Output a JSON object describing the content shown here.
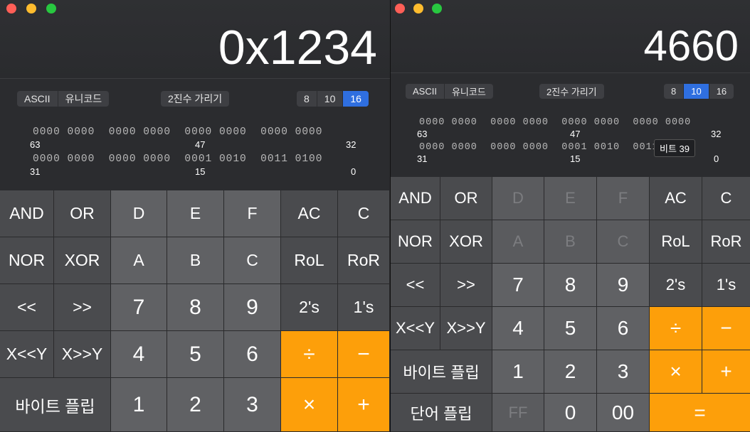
{
  "left": {
    "display": "0x1234",
    "ascii_label": "ASCII",
    "unicode_label": "유니코드",
    "hide_binary_label": "2진수 가리기",
    "bases": [
      "8",
      "10",
      "16"
    ],
    "selected_base": "16",
    "bits_row1": "0000 0000  0000 0000  0000 0000  0000 0000",
    "bits_row2": "0000 0000  0000 0000  0001 0010  0011 0100",
    "bit_labels": {
      "b63": "63",
      "b47": "47",
      "b32": "32",
      "b31": "31",
      "b15": "15",
      "b0": "0"
    },
    "keys": {
      "and": "AND",
      "or": "OR",
      "d": "D",
      "e": "E",
      "f": "F",
      "ac": "AC",
      "c": "C",
      "nor": "NOR",
      "xor": "XOR",
      "a": "A",
      "b": "B",
      "c2": "C",
      "rol": "RoL",
      "ror": "RoR",
      "shl": "<<",
      "shr": ">>",
      "n7": "7",
      "n8": "8",
      "n9": "9",
      "twos": "2's",
      "ones": "1's",
      "xshly": "X<<Y",
      "xshry": "X>>Y",
      "n4": "4",
      "n5": "5",
      "n6": "6",
      "div": "÷",
      "minus": "−",
      "byteflip": "바이트 플립",
      "n1": "1",
      "n2": "2",
      "n3": "3",
      "mul": "×",
      "plus": "+"
    }
  },
  "right": {
    "display": "4660",
    "ascii_label": "ASCII",
    "unicode_label": "유니코드",
    "hide_binary_label": "2진수 가리기",
    "bases": [
      "8",
      "10",
      "16"
    ],
    "selected_base": "10",
    "bits_row1": "0000 0000  0000 0000  0000 0000  0000 0000",
    "bits_row2": "0000 0000  0000 0000  0001 0010  0011 0100",
    "bit_labels": {
      "b63": "63",
      "b47": "47",
      "b32": "32",
      "b31": "31",
      "b15": "15",
      "b0": "0"
    },
    "tooltip": "비트 39",
    "keys": {
      "and": "AND",
      "or": "OR",
      "d": "D",
      "e": "E",
      "f": "F",
      "ac": "AC",
      "c": "C",
      "nor": "NOR",
      "xor": "XOR",
      "a": "A",
      "b": "B",
      "c2": "C",
      "rol": "RoL",
      "ror": "RoR",
      "shl": "<<",
      "shr": ">>",
      "n7": "7",
      "n8": "8",
      "n9": "9",
      "twos": "2's",
      "ones": "1's",
      "xshly": "X<<Y",
      "xshry": "X>>Y",
      "n4": "4",
      "n5": "5",
      "n6": "6",
      "div": "÷",
      "minus": "−",
      "byteflip": "바이트 플립",
      "n1": "1",
      "n2": "2",
      "n3": "3",
      "mul": "×",
      "plus": "+",
      "wordflip": "단어 플립",
      "ff": "FF",
      "n0": "0",
      "n00": "00",
      "equals": "="
    }
  },
  "colors": {
    "operator": "#fd9f0a",
    "selected_base": "#2f6fe0",
    "close": "#ff5f57",
    "minimize": "#febc2e",
    "zoom": "#28c840"
  }
}
